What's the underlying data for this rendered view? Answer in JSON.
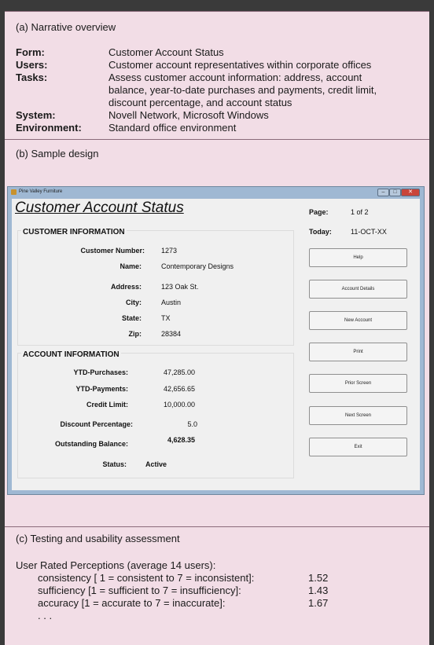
{
  "section_a": {
    "title": "(a) Narrative overview",
    "form_label": "Form:",
    "form_value": "Customer Account Status",
    "users_label": "Users:",
    "users_value": "Customer account representatives within corporate offices",
    "tasks_label": "Tasks:",
    "tasks_line1": "Assess customer account information: address, account",
    "tasks_line2": "balance, year-to-date purchases and payments, credit limit,",
    "tasks_line3": "discount percentage, and account status",
    "system_label": "System:",
    "system_value": "Novell Network, Microsoft Windows",
    "env_label": "Environment:",
    "env_value": "Standard office environment"
  },
  "section_b": {
    "title": "(b) Sample design",
    "window": {
      "title": "Pine Valley Furniture",
      "form_title": "Customer Account Status",
      "page_label": "Page:",
      "page_value": "1 of 2",
      "today_label": "Today:",
      "today_value": "11-OCT-XX",
      "customer_info": {
        "header": "CUSTOMER INFORMATION",
        "number_label": "Customer Number:",
        "number_value": "1273",
        "name_label": "Name:",
        "name_value": "Contemporary Designs",
        "address_label": "Address:",
        "address_value": "123 Oak St.",
        "city_label": "City:",
        "city_value": "Austin",
        "state_label": "State:",
        "state_value": "TX",
        "zip_label": "Zip:",
        "zip_value": "28384"
      },
      "account_info": {
        "header": "ACCOUNT INFORMATION",
        "ytd_purchases_label": "YTD-Purchases:",
        "ytd_purchases_value": "47,285.00",
        "ytd_payments_label": "YTD-Payments:",
        "ytd_payments_value": "42,656.65",
        "credit_limit_label": "Credit Limit:",
        "credit_limit_value": "10,000.00",
        "discount_label": "Discount Percentage:",
        "discount_value": "5.0",
        "balance_label": "Outstanding Balance:",
        "balance_value": "4,628.35",
        "status_label": "Status:",
        "status_value": "Active"
      },
      "buttons": {
        "help": "Help",
        "account_details": "Account Details",
        "new_account": "New Account",
        "print": "Print",
        "prior_screen": "Prior Screen",
        "next_screen": "Next Screen",
        "exit": "Exit"
      },
      "controls": {
        "minimize": "–",
        "maximize": "□",
        "close": "✕"
      }
    }
  },
  "section_c": {
    "title": "(c) Testing and usability assessment",
    "heading": "User Rated Perceptions (average 14 users):",
    "rows": [
      {
        "label": "consistency [ 1 = consistent to 7 = inconsistent]:",
        "value": "1.52"
      },
      {
        "label": "sufficiency [1 = sufficient to 7 = insufficiency]:",
        "value": "1.43"
      },
      {
        "label": "accuracy [1 = accurate to 7 = inaccurate]:",
        "value": "1.67"
      }
    ],
    "ellipsis": ". . ."
  },
  "colors": {
    "panel_bg": "#f2dde6",
    "outer_bg": "#3a3a3a",
    "window_frame": "#9fb8d3",
    "close_button": "#c9453a"
  }
}
